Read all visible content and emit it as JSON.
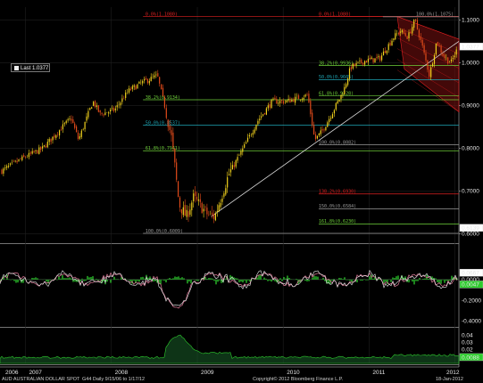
{
  "legend": {
    "last_label": "Last",
    "last_value": "1.0377"
  },
  "footer": {
    "instrument": "AUD  AUSTRALIAN DOLLAR SPOT",
    "mode": "G44  Daily  9/15/06 to 1/17/12",
    "copyright": "Copyright© 2012 Bloomberg Finance L.P.",
    "date": "18-Jan-2012"
  },
  "colors": {
    "background": "#000000",
    "grid": "#1f1f1f",
    "price_up": "#f2d21c",
    "price_down": "#e04a1a",
    "fib_red": "#e02020",
    "fib_teal": "#1fa6b5",
    "fib_green": "#6fd23a",
    "fib_grey": "#9a9a9a",
    "trend": "#d8d8d8",
    "osc_pink": "#e07a9a",
    "osc_white": "#f0f0f0",
    "osc_green": "#2dcc2d",
    "channel_fill": "#7a1010"
  },
  "chart_data": [
    {
      "type": "line",
      "panel": "price",
      "series": [
        {
          "name": "AUD spot",
          "style": "candle"
        }
      ],
      "x": [
        "2006-09",
        "2006-12",
        "2007-03",
        "2007-06",
        "2007-07",
        "2007-08",
        "2007-10",
        "2007-11",
        "2008-01",
        "2008-03",
        "2008-05",
        "2008-07",
        "2008-08",
        "2008-09",
        "2008-10",
        "2008-11",
        "2008-12",
        "2009-02",
        "2009-03",
        "2009-05",
        "2009-07",
        "2009-09",
        "2009-11",
        "2010-01",
        "2010-04",
        "2010-05",
        "2010-06",
        "2010-07",
        "2010-09",
        "2010-10",
        "2010-12",
        "2011-02",
        "2011-04",
        "2011-05",
        "2011-06",
        "2011-07",
        "2011-08",
        "2011-09",
        "2011-10",
        "2011-11",
        "2011-12",
        "2012-01"
      ],
      "y": [
        0.745,
        0.775,
        0.8,
        0.855,
        0.87,
        0.82,
        0.91,
        0.88,
        0.89,
        0.935,
        0.955,
        0.97,
        0.9,
        0.82,
        0.67,
        0.64,
        0.685,
        0.645,
        0.64,
        0.74,
        0.8,
        0.865,
        0.91,
        0.91,
        0.925,
        0.82,
        0.84,
        0.87,
        0.935,
        0.99,
        1.005,
        1.01,
        1.06,
        1.075,
        1.06,
        1.1,
        1.04,
        0.97,
        1.05,
        1.015,
        1.0,
        1.0377
      ],
      "ylim": [
        0.58,
        1.13
      ],
      "xtick_labels": [
        "2006",
        "2007",
        "2008",
        "2009",
        "2010",
        "2011",
        "2012"
      ],
      "ytick_labels": [
        "0.6000",
        "0.7000",
        "0.8000",
        "0.9000",
        "1.0000",
        "1.1000"
      ],
      "markers": [
        {
          "label": "1.0377",
          "value": 1.0377
        },
        {
          "label": "0.6139",
          "value": 0.6139
        }
      ],
      "fib_levels": [
        {
          "label": "0.0%(1.1080)",
          "value": 1.108,
          "color": "red",
          "group": "A"
        },
        {
          "label": "38.2%(0.9134)",
          "value": 0.9134,
          "color": "green",
          "group": "A"
        },
        {
          "label": "50.0%(0.8537)",
          "value": 0.8537,
          "color": "teal",
          "group": "A"
        },
        {
          "label": "61.8%(0.7941)",
          "value": 0.7941,
          "color": "green",
          "group": "A"
        },
        {
          "label": "100.0%(0.6009)",
          "value": 0.6009,
          "color": "grey",
          "group": "A"
        },
        {
          "label": "0.0%(1.1080)",
          "value": 1.108,
          "color": "red",
          "group": "B"
        },
        {
          "label": "38.2%(0.9936)",
          "value": 0.9936,
          "color": "green",
          "group": "B"
        },
        {
          "label": "50.0%(0.9605)",
          "value": 0.9605,
          "color": "teal",
          "group": "B"
        },
        {
          "label": "61.8%(0.9228)",
          "value": 0.9228,
          "color": "green",
          "group": "B"
        },
        {
          "label": "100.0%(0.8082)",
          "value": 0.8082,
          "color": "grey",
          "group": "B"
        },
        {
          "label": "138.2%(0.6930)",
          "value": 0.693,
          "color": "red",
          "group": "B"
        },
        {
          "label": "150.0%(0.6584)",
          "value": 0.6584,
          "color": "grey",
          "group": "B"
        },
        {
          "label": "161.8%(0.6230)",
          "value": 0.623,
          "color": "green",
          "group": "B"
        },
        {
          "label": "100.0%(1.1075)",
          "value": 1.1075,
          "color": "grey",
          "group": "C"
        }
      ]
    },
    {
      "type": "line",
      "panel": "oscillator",
      "ylim": [
        -0.45,
        0.12
      ],
      "ytick_labels": [
        "0.0000",
        "-0.2000",
        "-0.4000"
      ],
      "markers": [
        {
          "label": "0.0667",
          "value": 0.0667
        },
        {
          "label": "0.0047",
          "value": 0.0047
        }
      ]
    },
    {
      "type": "area",
      "panel": "volatility",
      "ylim": [
        0,
        0.045
      ],
      "ytick_labels": [
        "0.04",
        "0.03",
        "0.02",
        "0.01"
      ],
      "markers": [
        {
          "label": "0.0088",
          "value": 0.0088
        }
      ]
    }
  ]
}
